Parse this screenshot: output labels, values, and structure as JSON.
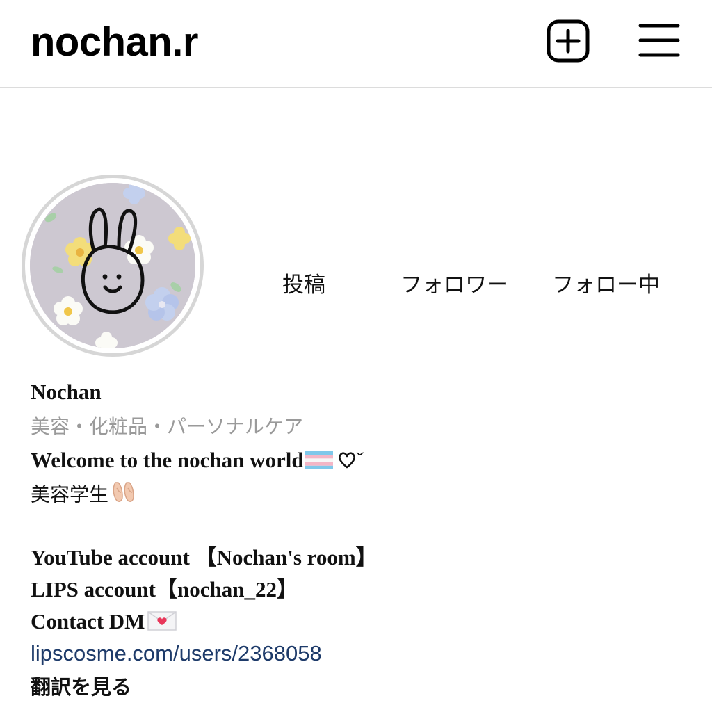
{
  "header": {
    "username": "nochan.r",
    "new_post_icon": "plus-square-icon",
    "menu_icon": "hamburger-menu-icon"
  },
  "profile": {
    "avatar_icon": "bunny-avatar-icon",
    "stats": {
      "posts_label": "投稿",
      "followers_label": "フォロワー",
      "following_label": "フォロー中"
    },
    "display_name": "Nochan",
    "category": "美容・化粧品・パーソナルケア",
    "bio": {
      "line1": "Welcome to the nochan world",
      "line1_suffix": "ˇ",
      "line2": "美容学生",
      "line3": "YouTube account 【Nochan's room】",
      "line4": "LIPS account【nochan_22】",
      "line5": "Contact DM",
      "icons": [
        "transgender-flag-icon",
        "heart-outline-icon",
        "shoe-icon",
        "love-letter-icon"
      ]
    },
    "link": "lipscosme.com/users/2368058",
    "translate_label": "翻訳を見る"
  },
  "colors": {
    "link": "#1e3b6a",
    "category": "#9a9a9a",
    "divider": "#dcdcdc",
    "avatar_ring": "#d6d6d6"
  }
}
